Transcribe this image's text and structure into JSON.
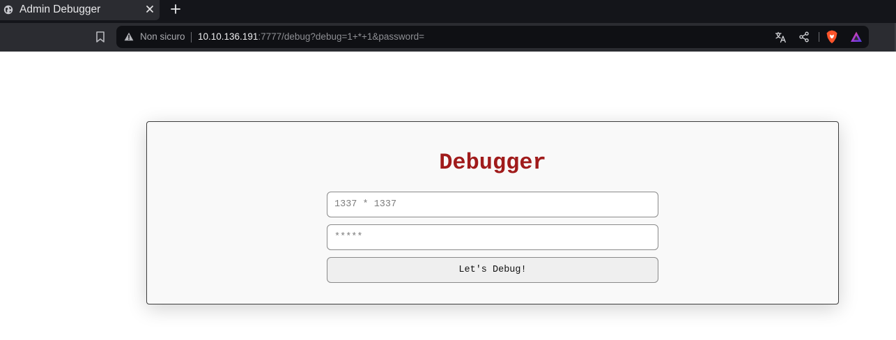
{
  "browser": {
    "tab": {
      "title": "Admin Debugger"
    },
    "address_bar": {
      "security_label": "Non sicuro",
      "url_host": "10.10.136.191",
      "url_rest": ":7777/debug?debug=1+*+1&password="
    },
    "icons": [
      "globe-icon",
      "close-icon",
      "plus-icon",
      "bookmark-icon",
      "warning-icon",
      "translate-icon",
      "share-icon",
      "brave-icon",
      "brave-rewards-icon"
    ]
  },
  "page": {
    "title": "Debugger",
    "expression_input": {
      "value": "",
      "placeholder": "1337 * 1337"
    },
    "password_input": {
      "value": "",
      "placeholder": "*****"
    },
    "submit_label": "Let's Debug!",
    "title_color": "#a01b1b"
  }
}
